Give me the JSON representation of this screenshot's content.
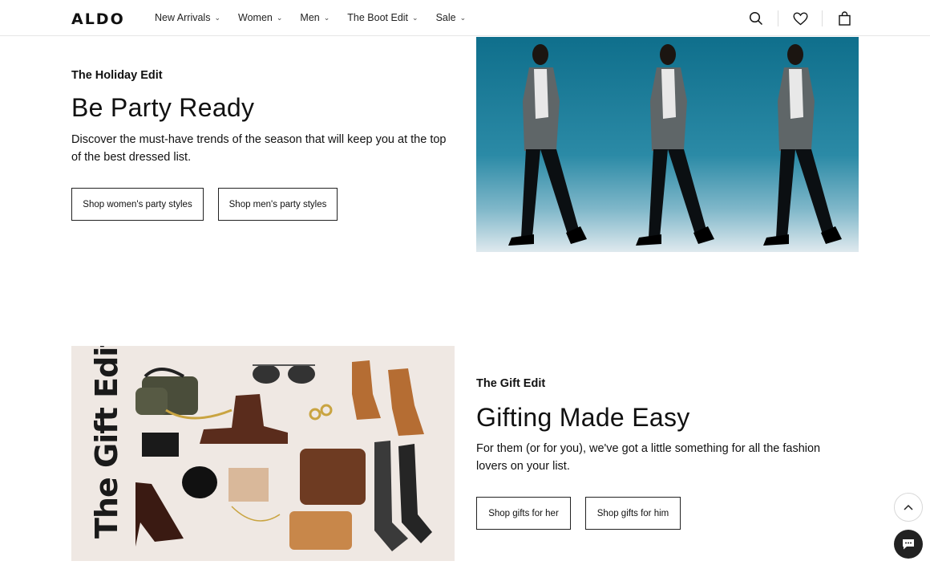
{
  "header": {
    "logo": "ALDO",
    "nav": [
      {
        "label": "New Arrivals"
      },
      {
        "label": "Women"
      },
      {
        "label": "Men"
      },
      {
        "label": "The Boot Edit"
      },
      {
        "label": "Sale"
      }
    ],
    "icons": [
      "search-icon",
      "heart-icon",
      "shopping-bag-icon"
    ]
  },
  "holiday": {
    "eyebrow": "The Holiday Edit",
    "headline": "Be Party Ready",
    "description": "Discover the must-have trends of the season that will keep you at the top of the best dressed list.",
    "buttons": [
      "Shop women's party styles",
      "Shop men's party styles"
    ]
  },
  "gift": {
    "image_title": "The Gift Edit",
    "eyebrow": "The Gift Edit",
    "headline": "Gifting Made Easy",
    "description": "For them (or for you), we've got a little something for all the fashion lovers on your list.",
    "buttons": [
      "Shop gifts for her",
      "Shop gifts for him"
    ]
  },
  "colors": {
    "text": "#111111",
    "hero_teal": "#0f6f8c",
    "gift_bg": "#efe8e3",
    "chat_bg": "#222222"
  }
}
